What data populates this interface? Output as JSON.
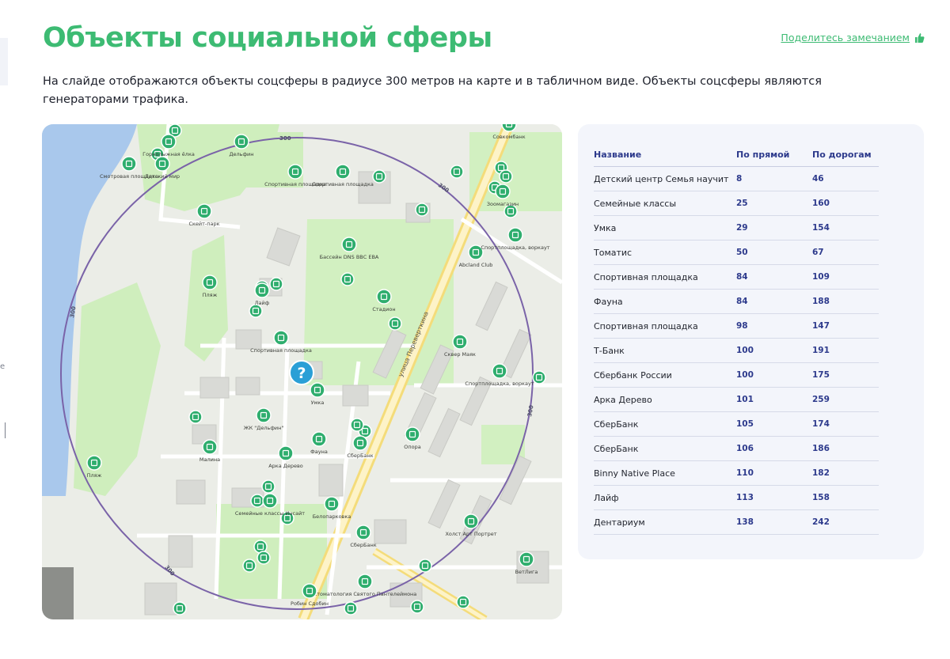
{
  "page": {
    "title": "Объекты социальной сферы",
    "share_label": "Поделитесь замечанием",
    "description": "На слайде отображаются объекты соцсферы в радиусе 300 метров на карте и в табличном виде. Объекты соцсферы являются генераторами трафика.",
    "accent_color": "#3dbb73"
  },
  "map": {
    "radius_labels": [
      "300",
      "300",
      "300",
      "300",
      "300"
    ],
    "street_label": "улица Переверткина",
    "center_marker_glyph": "?",
    "poi_labels": [
      "Горнолыжная ёлка",
      "Детский мир",
      "Смотровая площадка",
      "Дельфин",
      "Спортивная площадка",
      "Скейт-парк",
      "Бассейн DNS ВВС EBA",
      "Стадион",
      "Пляж",
      "Лайф",
      "Спортивная площадка",
      "Умка",
      "ЖК \"Дельфин\"",
      "Малина",
      "Фауна",
      "Арка Дерево",
      "СберБанк",
      "Семейные классы Инсайт",
      "Белопарковка",
      "Сквер Маяк",
      "Спортплощадка, воркаут",
      "Abcland Club",
      "Спортплощадка, воркаут",
      "Зоомагазин",
      "Совкомбанк",
      "Спортивная площадка",
      "Пляж",
      "Холст Арт Портрет",
      "СберБанк",
      "Стоматология Святого Пантелеймона",
      "Робин Сдобин",
      "ВетЛига",
      "Опора"
    ]
  },
  "table": {
    "headers": [
      "Название",
      "По прямой",
      "По дорогам"
    ],
    "rows": [
      [
        "Детский центр Семья научит",
        "8",
        "46"
      ],
      [
        "Семейные классы",
        "25",
        "160"
      ],
      [
        "Умка",
        "29",
        "154"
      ],
      [
        "Томатис",
        "50",
        "67"
      ],
      [
        "Спортивная площадка",
        "84",
        "109"
      ],
      [
        "Фауна",
        "84",
        "188"
      ],
      [
        "Спортивная площадка",
        "98",
        "147"
      ],
      [
        "Т-Банк",
        "100",
        "191"
      ],
      [
        "Сбербанк России",
        "100",
        "175"
      ],
      [
        "Арка Дерево",
        "101",
        "259"
      ],
      [
        "СберБанк",
        "105",
        "174"
      ],
      [
        "СберБанк",
        "106",
        "186"
      ],
      [
        "Binny Native Place",
        "110",
        "182"
      ],
      [
        "Лайф",
        "113",
        "158"
      ],
      [
        "Дентариум",
        "138",
        "242"
      ]
    ]
  }
}
